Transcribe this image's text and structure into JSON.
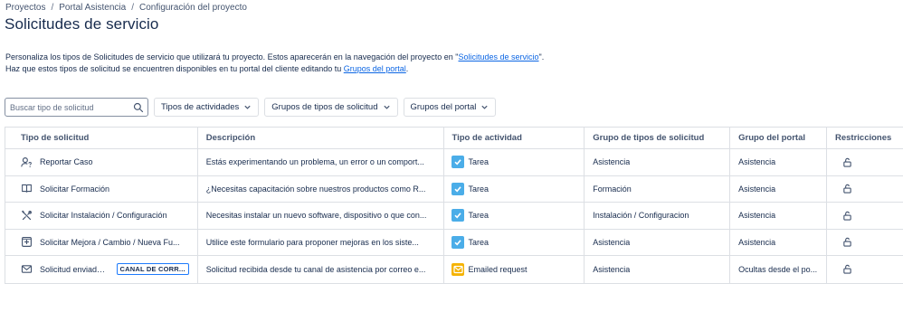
{
  "breadcrumb": {
    "items": [
      "Proyectos",
      "Portal Asistencia",
      "Configuración del proyecto"
    ],
    "separator": "/"
  },
  "page": {
    "title": "Solicitudes de servicio"
  },
  "description": {
    "line1_prefix": "Personaliza los tipos de Solicitudes de servicio que utilizará tu proyecto. Estos aparecerán en la navegación del proyecto en \"",
    "line1_link": "Solicitudes de servicio",
    "line1_suffix": "\".",
    "line2_prefix": "Haz que estos tipos de solicitud se encuentren disponibles en tu portal del cliente editando tu ",
    "line2_link": "Grupos del portal",
    "line2_suffix": "."
  },
  "toolbar": {
    "search_placeholder": "Buscar tipo de solicitud",
    "filters": [
      "Tipos de actividades",
      "Grupos de tipos de solicitud",
      "Grupos del portal"
    ]
  },
  "table": {
    "columns": [
      "Tipo de solicitud",
      "Descripción",
      "Tipo de actividad",
      "Grupo de tipos de solicitud",
      "Grupo del portal",
      "Restricciones"
    ],
    "rows": [
      {
        "icon": "person-question-icon",
        "name": "Reportar Caso",
        "description": "Estás experimentando un problema, un error o un comport...",
        "activity": "Tarea",
        "activity_icon": "task",
        "group": "Asistencia",
        "portal_group": "Asistencia"
      },
      {
        "icon": "book-icon",
        "name": "Solicitar Formación",
        "description": "¿Necesitas capacitación sobre nuestros productos como R...",
        "activity": "Tarea",
        "activity_icon": "task",
        "group": "Formación",
        "portal_group": "Asistencia"
      },
      {
        "icon": "tools-icon",
        "name": "Solicitar Instalación / Configuración",
        "description": "Necesitas instalar un nuevo software, dispositivo o que con...",
        "activity": "Tarea",
        "activity_icon": "task",
        "group": "Instalación / Configuracion",
        "portal_group": "Asistencia"
      },
      {
        "icon": "add-box-icon",
        "name": "Solicitar Mejora / Cambio / Nueva Fu...",
        "description": "Utilice este formulario para proponer mejoras en los siste...",
        "activity": "Tarea",
        "activity_icon": "task",
        "group": "Asistencia",
        "portal_group": "Asistencia"
      },
      {
        "icon": "mail-icon",
        "name": "Solicitud enviada ...",
        "badge": "CANAL DE CORR...",
        "description": "Solicitud recibida desde tu canal de asistencia por correo e...",
        "activity": "Emailed request",
        "activity_icon": "email",
        "group": "Asistencia",
        "portal_group": "Ocultas desde el po..."
      }
    ]
  },
  "colors": {
    "link": "#0c66e4",
    "task": "#4bade8",
    "email": "#f5b301",
    "border": "#dcdfe4"
  }
}
